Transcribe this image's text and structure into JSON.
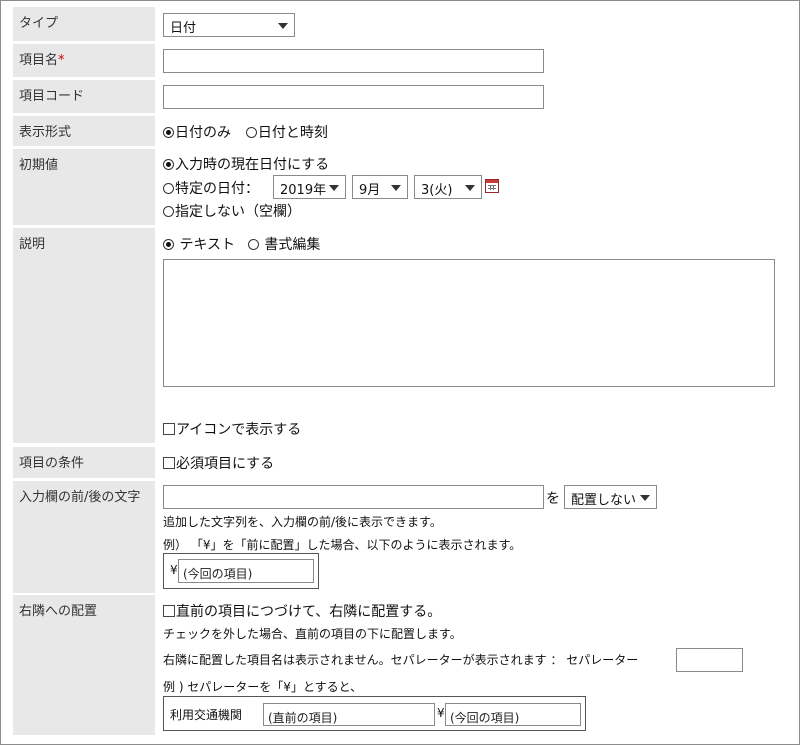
{
  "fields": {
    "type": {
      "label": "タイプ",
      "value": "日付"
    },
    "name": {
      "label": "項目名",
      "required_mark": "*",
      "value": ""
    },
    "code": {
      "label": "項目コード",
      "value": ""
    },
    "display_format": {
      "label": "表示形式",
      "options": [
        "日付のみ",
        "日付と時刻"
      ],
      "selected": "日付のみ"
    },
    "initial_value": {
      "label": "初期値",
      "option_current": "入力時の現在日付にする",
      "option_specific": "特定の日付：",
      "option_none": "指定しない（空欄）",
      "selected": "入力時の現在日付にする",
      "year": "2019年",
      "month": "9月",
      "day": "3(火)"
    },
    "description": {
      "label": "説明",
      "mode_text": "テキスト",
      "mode_rich": "書式編集",
      "selected_mode": "テキスト",
      "value": "",
      "show_icon_label": "アイコンで表示する",
      "show_icon_checked": false
    },
    "conditions": {
      "label": "項目の条件",
      "required_label": "必須項目にする",
      "required_checked": false
    },
    "affix": {
      "label": "入力欄の前/後の文字",
      "value": "",
      "wo": "を",
      "placement": "配置しない",
      "help1": "追加した文字列を、入力欄の前/後に表示できます。",
      "help2": "例） 「¥」を「前に配置」した場合、以下のように表示されます。",
      "example_prefix": "¥",
      "example_field": "(今回の項目)"
    },
    "right_placement": {
      "label": "右隣への配置",
      "checkbox_label": "直前の項目につづけて、右隣に配置する。",
      "checked": false,
      "help1": "チェックを外した場合、直前の項目の下に配置します。",
      "help2": "右隣に配置した項目名は表示されません。セパレーターが表示されます ： セパレーター",
      "separator_value": "",
      "help3": "例 ) セパレーターを「¥」とすると、",
      "example_label": "利用交通機関",
      "example_prev": "(直前の項目)",
      "example_sep": "¥",
      "example_current": "(今回の項目)"
    }
  }
}
